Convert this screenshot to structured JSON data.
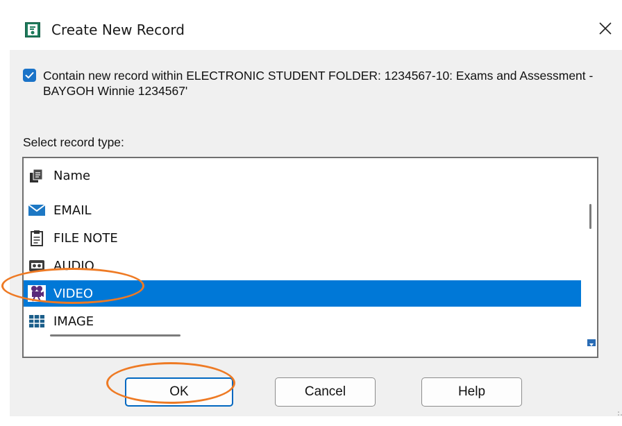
{
  "window": {
    "title": "Create New Record",
    "close_glyph": "✕"
  },
  "contain": {
    "checked": true,
    "text": "Contain new record within ELECTRONIC STUDENT FOLDER: 1234567-10: Exams and Assessment - BAYGOH Winnie 1234567'"
  },
  "list": {
    "label": "Select record type:",
    "header": "Name",
    "items": [
      {
        "label": "EMAIL",
        "icon": "envelope-icon"
      },
      {
        "label": "FILE NOTE",
        "icon": "clipboard-icon"
      },
      {
        "label": "AUDIO",
        "icon": "cassette-icon"
      },
      {
        "label": "VIDEO",
        "icon": "movie-camera-icon",
        "selected": true
      },
      {
        "label": "IMAGE",
        "icon": "image-grid-icon"
      }
    ]
  },
  "buttons": {
    "ok": "OK",
    "cancel": "Cancel",
    "help": "Help"
  },
  "colors": {
    "selection": "#0078d7",
    "checkbox": "#1a73c8",
    "annotation": "#ee7a24"
  }
}
